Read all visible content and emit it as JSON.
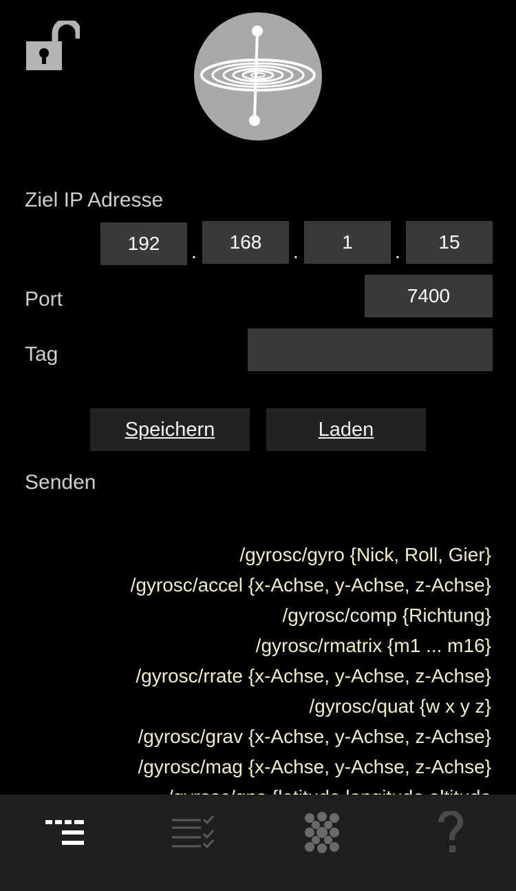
{
  "form": {
    "ip_label": "Ziel IP Adresse",
    "ip": [
      "192",
      "168",
      "1",
      "15"
    ],
    "ip_separator": ".",
    "port_label": "Port",
    "port_value": "7400",
    "tag_label": "Tag",
    "tag_value": ""
  },
  "buttons": {
    "save": "Speichern",
    "load": "Laden"
  },
  "send": {
    "heading": "Senden",
    "addresses": [
      "/gyrosc/gyro {Nick, Roll, Gier}",
      "/gyrosc/accel {x-Achse, y-Achse, z-Achse}",
      "/gyrosc/comp {Richtung}",
      "/gyrosc/rmatrix {m1 ... m16}",
      "/gyrosc/rrate {x-Achse, y-Achse, z-Achse}",
      "/gyrosc/quat {w x y z}",
      "/gyrosc/grav {x-Achse, y-Achse, z-Achse}",
      "/gyrosc/mag {x-Achse, y-Achse, z-Achse}",
      "/gyrosc/gps {latitude longitude altitude"
    ]
  },
  "tabbar": {
    "tabs": [
      {
        "icon": "settings-lines-icon",
        "active": true
      },
      {
        "icon": "checklist-icon",
        "active": false
      },
      {
        "icon": "dots-grid-icon",
        "active": false
      },
      {
        "icon": "help-icon",
        "active": false
      }
    ]
  },
  "colors": {
    "background": "#000000",
    "field": "#3a3a3a",
    "button": "#222222",
    "address_text": "#f4eec0",
    "tabbar": "#1f1f1f"
  }
}
